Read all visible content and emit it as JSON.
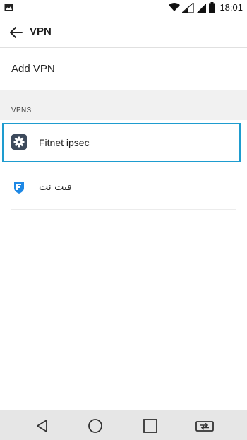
{
  "status_bar": {
    "time": "18:01",
    "icons": [
      "gallery-icon",
      "wifi-icon",
      "signal-icon",
      "signal-icon",
      "battery-icon"
    ]
  },
  "app_bar": {
    "title": "VPN",
    "back_icon": "arrow-left-icon"
  },
  "add_vpn": {
    "label": "Add VPN"
  },
  "vpns_section": {
    "header": "VPNS",
    "items": [
      {
        "label": "Fitnet ipsec",
        "icon": "gear-icon",
        "icon_color": "#3d4a5c"
      },
      {
        "label": "فیت نت",
        "icon": "shield-app-icon",
        "icon_color": "#1e88e5"
      }
    ]
  },
  "nav_bar": {
    "buttons": [
      "back-triangle-icon",
      "home-circle-icon",
      "recents-square-icon",
      "dual-window-icon"
    ]
  },
  "colors": {
    "focus_ring": "#1e9ccf",
    "section_bg": "#f1f1f1",
    "nav_bg": "#e6e6e6"
  }
}
